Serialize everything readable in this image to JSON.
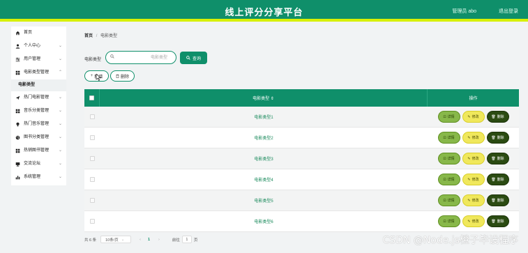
{
  "header": {
    "title": "线上评分分享平台",
    "admin": "管理员 abo",
    "logout": "退出登录",
    "accent": "#0f8f6a",
    "stripe": "#d7f000"
  },
  "sidebar": {
    "items": [
      {
        "label": "首页",
        "icon": "home-icon",
        "chevron": false
      },
      {
        "label": "个人中心",
        "icon": "user-icon",
        "chevron": true
      },
      {
        "label": "用户管理",
        "icon": "sliders-icon",
        "chevron": true
      },
      {
        "label": "电影类型管理",
        "icon": "grid-icon",
        "chevron": true
      }
    ],
    "sub_item": "电影类型",
    "items2": [
      {
        "label": "热门电影管理",
        "icon": "send-icon",
        "chevron": true
      },
      {
        "label": "音乐分类管理",
        "icon": "grid-icon",
        "chevron": true
      },
      {
        "label": "热门音乐管理",
        "icon": "bulb-icon",
        "chevron": true
      },
      {
        "label": "图书分类管理",
        "icon": "palette-icon",
        "chevron": true
      },
      {
        "label": "热销图书管理",
        "icon": "grid-icon",
        "chevron": true
      },
      {
        "label": "交流论坛",
        "icon": "monitor-icon",
        "chevron": true
      },
      {
        "label": "系统管理",
        "icon": "chart-icon",
        "chevron": true
      }
    ]
  },
  "breadcrumb": {
    "home": "首页",
    "sep": "/",
    "current": "电影类型"
  },
  "search": {
    "label": "电影类型",
    "placeholder": "电影类型",
    "button": "查询"
  },
  "actions": {
    "add": "新增",
    "delete": "删除"
  },
  "table": {
    "col_name": "电影类型 ⇕",
    "col_ops": "操作",
    "rows": [
      "电影类型1",
      "电影类型2",
      "电影类型3",
      "电影类型4",
      "电影类型5",
      "电影类型6"
    ],
    "btn_detail": "详情",
    "btn_edit": "修改",
    "btn_delete": "删除"
  },
  "pager": {
    "total": "共 6 条",
    "per_page": "10条/页",
    "prev": "‹",
    "page": "1",
    "next": "›",
    "goto": "前往",
    "goto_value": "1",
    "unit": "页"
  },
  "watermark": "CSDN @Node.js橙子毕设程序"
}
